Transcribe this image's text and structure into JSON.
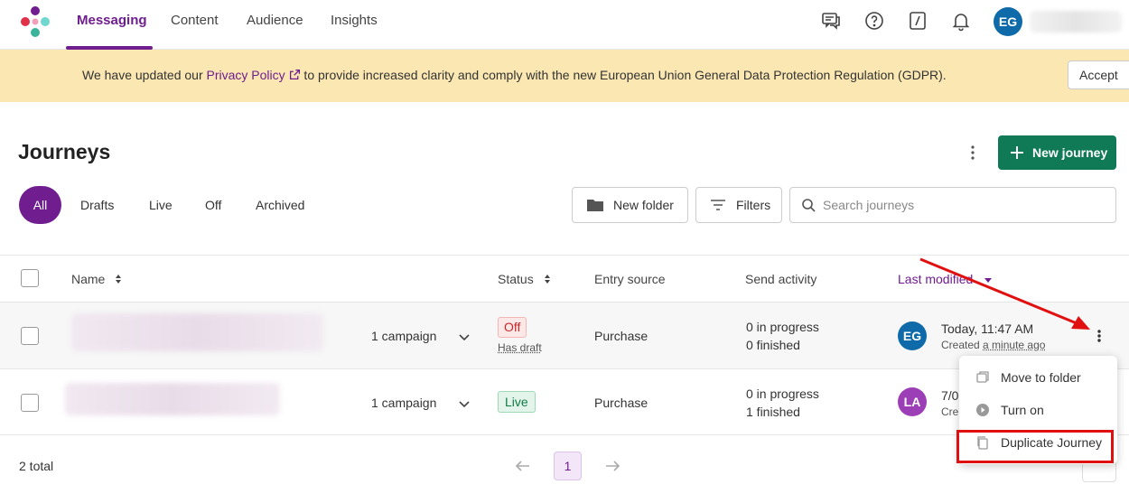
{
  "nav": {
    "tabs": [
      {
        "label": "Messaging",
        "active": true
      },
      {
        "label": "Content"
      },
      {
        "label": "Audience"
      },
      {
        "label": "Insights"
      }
    ],
    "icons": [
      "feedback-icon",
      "help-icon",
      "slash-command-icon",
      "bell-icon"
    ],
    "user_initials": "EG"
  },
  "banner": {
    "text_before": "We have updated our ",
    "link_text": "Privacy Policy",
    "text_after": " to provide increased clarity and comply with the new European Union General Data Protection Regulation (GDPR).",
    "accept_label": "Accept"
  },
  "page": {
    "title": "Journeys",
    "new_journey_label": "New journey"
  },
  "filters": {
    "tabs": [
      "All",
      "Drafts",
      "Live",
      "Off",
      "Archived"
    ],
    "active": "All",
    "new_folder_label": "New folder",
    "filters_label": "Filters",
    "search_placeholder": "Search journeys"
  },
  "table": {
    "columns": [
      "Name",
      "Status",
      "Entry source",
      "Send activity",
      "Last modified"
    ],
    "rows": [
      {
        "campaigns": "1 campaign",
        "status": "Off",
        "status_note": "Has draft",
        "entry_source": "Purchase",
        "in_progress": "0 in progress",
        "finished": "0 finished",
        "avatar_initials": "EG",
        "modified": "Today, 11:47 AM",
        "created_prefix": "Created",
        "created_rel": "a minute ago"
      },
      {
        "campaigns": "1 campaign",
        "status": "Live",
        "entry_source": "Purchase",
        "in_progress": "0 in progress",
        "finished": "1 finished",
        "avatar_initials": "LA",
        "modified": "7/0",
        "created_prefix": "Cre"
      }
    ]
  },
  "context_menu": {
    "items": [
      {
        "label": "Move to folder",
        "icon": "move-folder-icon"
      },
      {
        "label": "Turn on",
        "icon": "play-icon"
      },
      {
        "label": "Duplicate Journey",
        "icon": "copy-icon"
      }
    ]
  },
  "footer": {
    "total": "2 total",
    "current_page": "1"
  },
  "colors": {
    "brand": "#6f1d8f",
    "primary_button": "#0f7a55",
    "banner_bg": "#fbe7b2",
    "annotation_red": "#e01010"
  }
}
